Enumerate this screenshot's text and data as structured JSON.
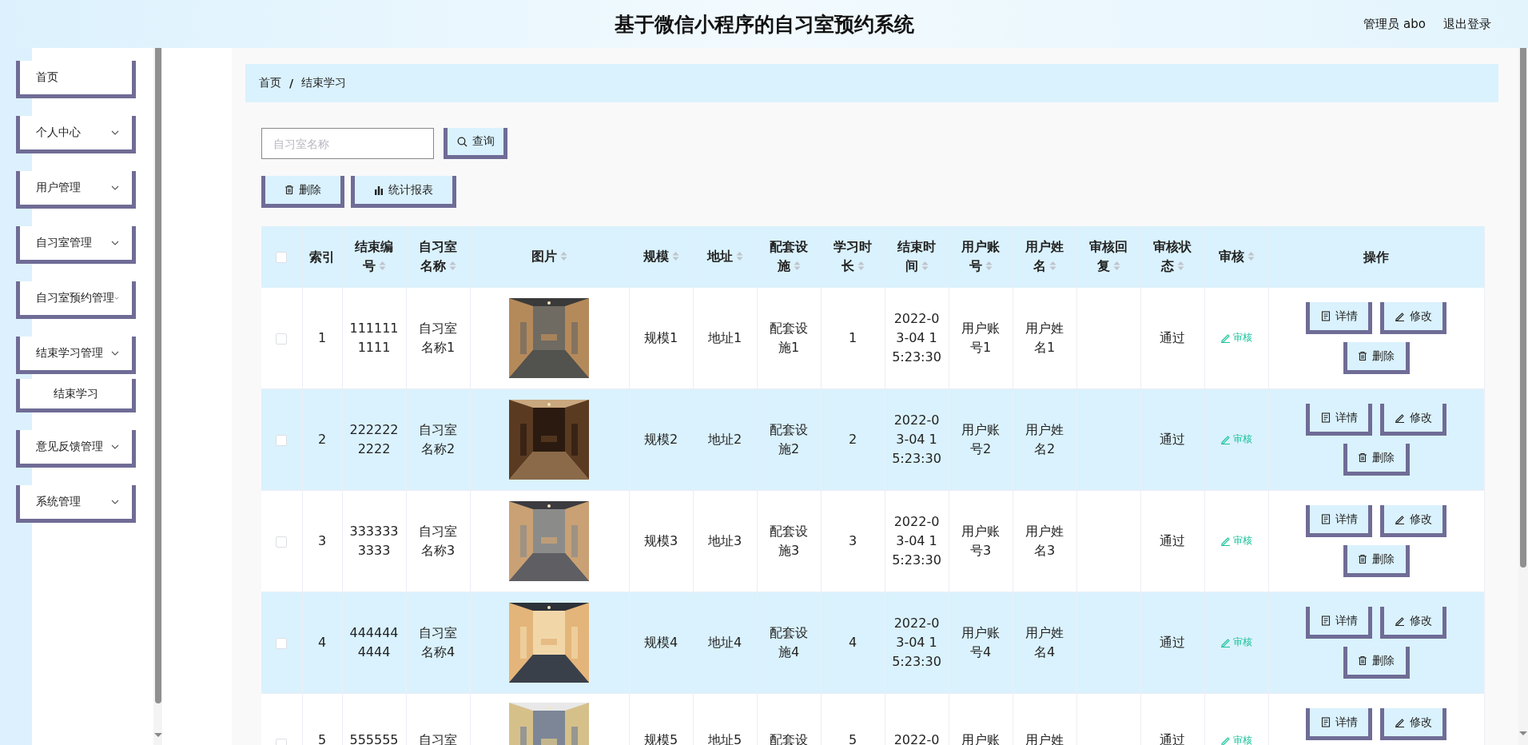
{
  "header": {
    "title": "基于微信小程序的自习室预约系统",
    "user": "管理员 abo",
    "logout": "退出登录"
  },
  "sidebar": {
    "items": [
      {
        "label": "首页",
        "kind": "link"
      },
      {
        "label": "个人中心",
        "kind": "submenu"
      },
      {
        "label": "用户管理",
        "kind": "submenu"
      },
      {
        "label": "自习室管理",
        "kind": "submenu"
      },
      {
        "label": "自习室预约管理",
        "kind": "submenu"
      },
      {
        "label": "结束学习管理",
        "kind": "submenu",
        "children": [
          {
            "label": "结束学习"
          }
        ]
      },
      {
        "label": "意见反馈管理",
        "kind": "submenu"
      },
      {
        "label": "系统管理",
        "kind": "submenu"
      }
    ]
  },
  "breadcrumb": {
    "items": [
      "首页",
      "结束学习"
    ],
    "separator": "/"
  },
  "search": {
    "placeholder": "自习室名称",
    "button": "查询"
  },
  "toolbar": [
    {
      "label": "删除",
      "kind": "delete"
    },
    {
      "label": "统计报表",
      "kind": "report"
    }
  ],
  "table": {
    "select_all": {
      "checked": false
    },
    "columns": [
      {
        "label": "索引",
        "kind": "text",
        "sortable": false
      },
      {
        "label": "结束编号",
        "kind": "text",
        "sortable": true
      },
      {
        "label": "自习室名称",
        "kind": "text",
        "sortable": true
      },
      {
        "label": "图片",
        "kind": "picture",
        "sortable": true
      },
      {
        "label": "规模",
        "kind": "text",
        "sortable": true
      },
      {
        "label": "地址",
        "kind": "text",
        "sortable": true
      },
      {
        "label": "配套设施",
        "kind": "text",
        "sortable": true
      },
      {
        "label": "学习时长",
        "kind": "text",
        "sortable": true
      },
      {
        "label": "结束时间",
        "kind": "text",
        "sortable": true
      },
      {
        "label": "用户账号",
        "kind": "text",
        "sortable": true
      },
      {
        "label": "用户姓名",
        "kind": "text",
        "sortable": true
      },
      {
        "label": "审核回复",
        "kind": "text",
        "sortable": true
      },
      {
        "label": "审核状态",
        "kind": "text",
        "sortable": true
      },
      {
        "label": "审核",
        "kind": "audit",
        "sortable": true
      },
      {
        "label": "操作",
        "kind": "actions",
        "sortable": false
      }
    ],
    "rows": [
      {
        "checked": false,
        "cells": [
          "1",
          "1111111111",
          "自习室名称1",
          {
            "kind": "picture"
          },
          "规模1",
          "地址1",
          "配套设施1",
          "1",
          "2022-03-04 15:23:30",
          "用户账号1",
          "用户姓名1",
          null,
          "通过",
          "审核",
          [
            {
              "label": "详情",
              "kind": "detail"
            },
            {
              "label": "修改",
              "kind": "edit"
            },
            {
              "label": "删除",
              "kind": "delete"
            }
          ]
        ]
      },
      {
        "checked": false,
        "cells": [
          "2",
          "2222222222",
          "自习室名称2",
          {
            "kind": "picture"
          },
          "规模2",
          "地址2",
          "配套设施2",
          "2",
          "2022-03-04 15:23:30",
          "用户账号2",
          "用户姓名2",
          null,
          "通过",
          "审核",
          [
            {
              "label": "详情",
              "kind": "detail"
            },
            {
              "label": "修改",
              "kind": "edit"
            },
            {
              "label": "删除",
              "kind": "delete"
            }
          ]
        ]
      },
      {
        "checked": false,
        "cells": [
          "3",
          "3333333333",
          "自习室名称3",
          {
            "kind": "picture"
          },
          "规模3",
          "地址3",
          "配套设施3",
          "3",
          "2022-03-04 15:23:30",
          "用户账号3",
          "用户姓名3",
          null,
          "通过",
          "审核",
          [
            {
              "label": "详情",
              "kind": "detail"
            },
            {
              "label": "修改",
              "kind": "edit"
            },
            {
              "label": "删除",
              "kind": "delete"
            }
          ]
        ]
      },
      {
        "checked": false,
        "cells": [
          "4",
          "4444444444",
          "自习室名称4",
          {
            "kind": "picture"
          },
          "规模4",
          "地址4",
          "配套设施4",
          "4",
          "2022-03-04 15:23:30",
          "用户账号4",
          "用户姓名4",
          null,
          "通过",
          "审核",
          [
            {
              "label": "详情",
              "kind": "detail"
            },
            {
              "label": "修改",
              "kind": "edit"
            },
            {
              "label": "删除",
              "kind": "delete"
            }
          ]
        ]
      },
      {
        "checked": false,
        "cells": [
          "5",
          "555555",
          "自习室",
          {
            "kind": "picture"
          },
          "规模5",
          "地址5",
          "配套设",
          "5",
          "2022-0",
          "用户账",
          "用户姓",
          null,
          "通过",
          "审核",
          [
            {
              "label": "详情",
              "kind": "detail"
            },
            {
              "label": "修改",
              "kind": "edit"
            }
          ]
        ]
      }
    ]
  }
}
